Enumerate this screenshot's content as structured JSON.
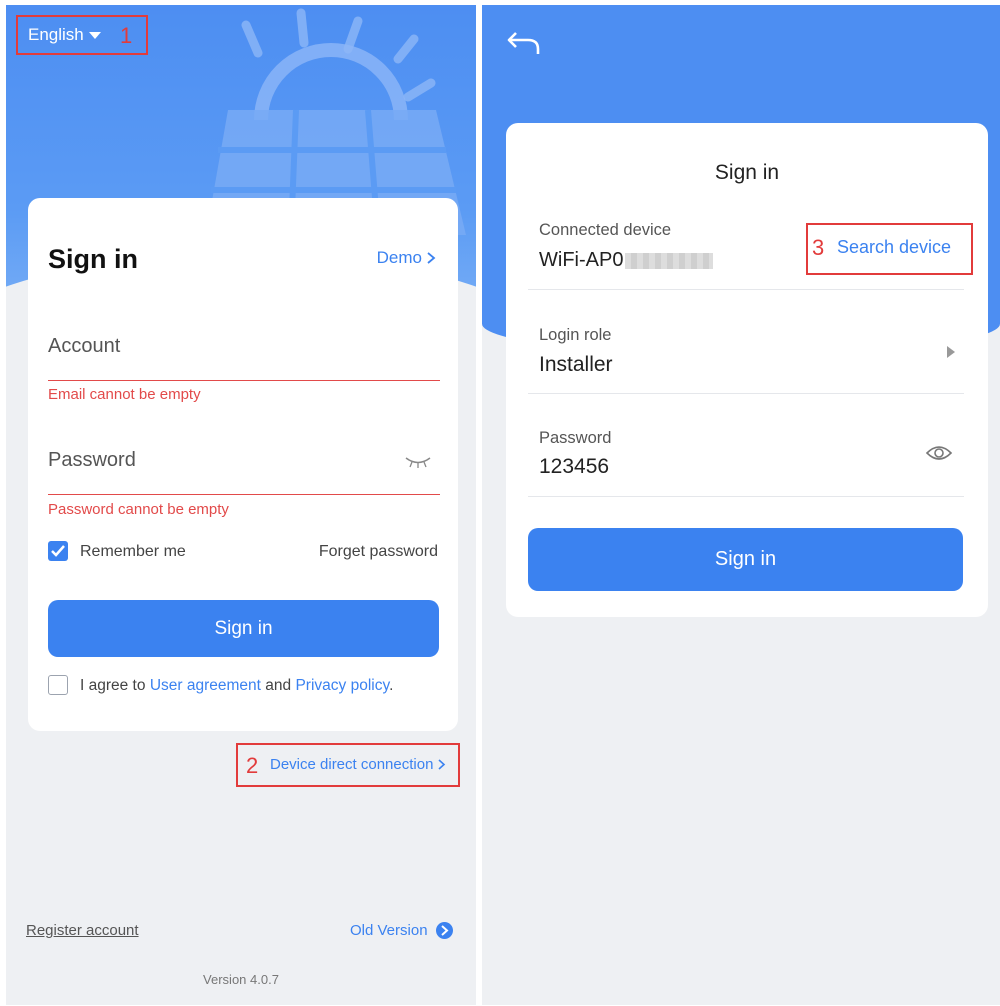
{
  "left": {
    "language": "English",
    "annotations": [
      "1",
      "2"
    ],
    "title": "Sign in",
    "demo_label": "Demo",
    "account_placeholder": "Account",
    "account_error": "Email cannot be empty",
    "password_placeholder": "Password",
    "password_error": "Password cannot be empty",
    "remember_label": "Remember me",
    "remember_checked": true,
    "forget_password": "Forget password",
    "sign_in_button": "Sign in",
    "agree_prefix": "I agree to",
    "user_agreement": "User agreement",
    "and_text": "and",
    "privacy_policy": "Privacy policy",
    "agree_suffix": ".",
    "device_direct": "Device direct connection",
    "register_account": "Register account",
    "old_version": "Old Version",
    "version": "Version 4.0.7"
  },
  "right": {
    "annotation": "3",
    "title": "Sign in",
    "connected_device_label": "Connected device",
    "connected_device_value": "WiFi-AP0",
    "search_device": "Search device",
    "login_role_label": "Login role",
    "login_role_value": "Installer",
    "password_label": "Password",
    "password_value": "123456",
    "sign_in_button": "Sign in"
  },
  "colors": {
    "primary": "#3b82f0",
    "header": "#4d8ef2",
    "annotation": "#e23b3b",
    "error": "#e24a4a"
  },
  "icons": [
    "caret-down-icon",
    "chevron-right-icon",
    "closed-eye-icon",
    "check-icon",
    "arrow-right-circle-icon",
    "back-arrow-icon",
    "triangle-right-icon",
    "eye-icon"
  ]
}
